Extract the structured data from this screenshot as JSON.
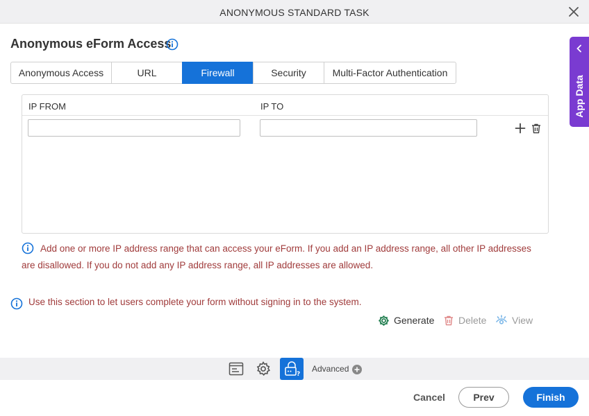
{
  "window": {
    "title": "ANONYMOUS STANDARD TASK"
  },
  "page": {
    "heading": "Anonymous eForm Access"
  },
  "tabs": [
    {
      "label": "Anonymous Access",
      "active": false
    },
    {
      "label": "URL",
      "active": false
    },
    {
      "label": "Firewall",
      "active": true
    },
    {
      "label": "Security",
      "active": false
    },
    {
      "label": "Multi-Factor Authentication",
      "active": false
    }
  ],
  "grid": {
    "col_from": "IP FROM",
    "col_to": "IP TO",
    "row": {
      "ip_from": "",
      "ip_to": ""
    }
  },
  "notes": {
    "firewall": "Add one or more IP address range that can access your eForm. If you add an IP address range, all other IP addresses are disallowed. If you do not add any IP address range, all IP addresses are allowed.",
    "section": "Use this section to let users complete your form without signing in to the system."
  },
  "actions": {
    "generate": "Generate",
    "delete": "Delete",
    "view": "View"
  },
  "bottombar": {
    "advanced": "Advanced"
  },
  "footer": {
    "cancel": "Cancel",
    "prev": "Prev",
    "finish": "Finish"
  },
  "side_panel": {
    "label": "App Data"
  },
  "colors": {
    "accent": "#1572d9",
    "note_text": "#a03b3b",
    "side_panel": "#7a3bd1",
    "generate_icon": "#1a7a4a"
  }
}
